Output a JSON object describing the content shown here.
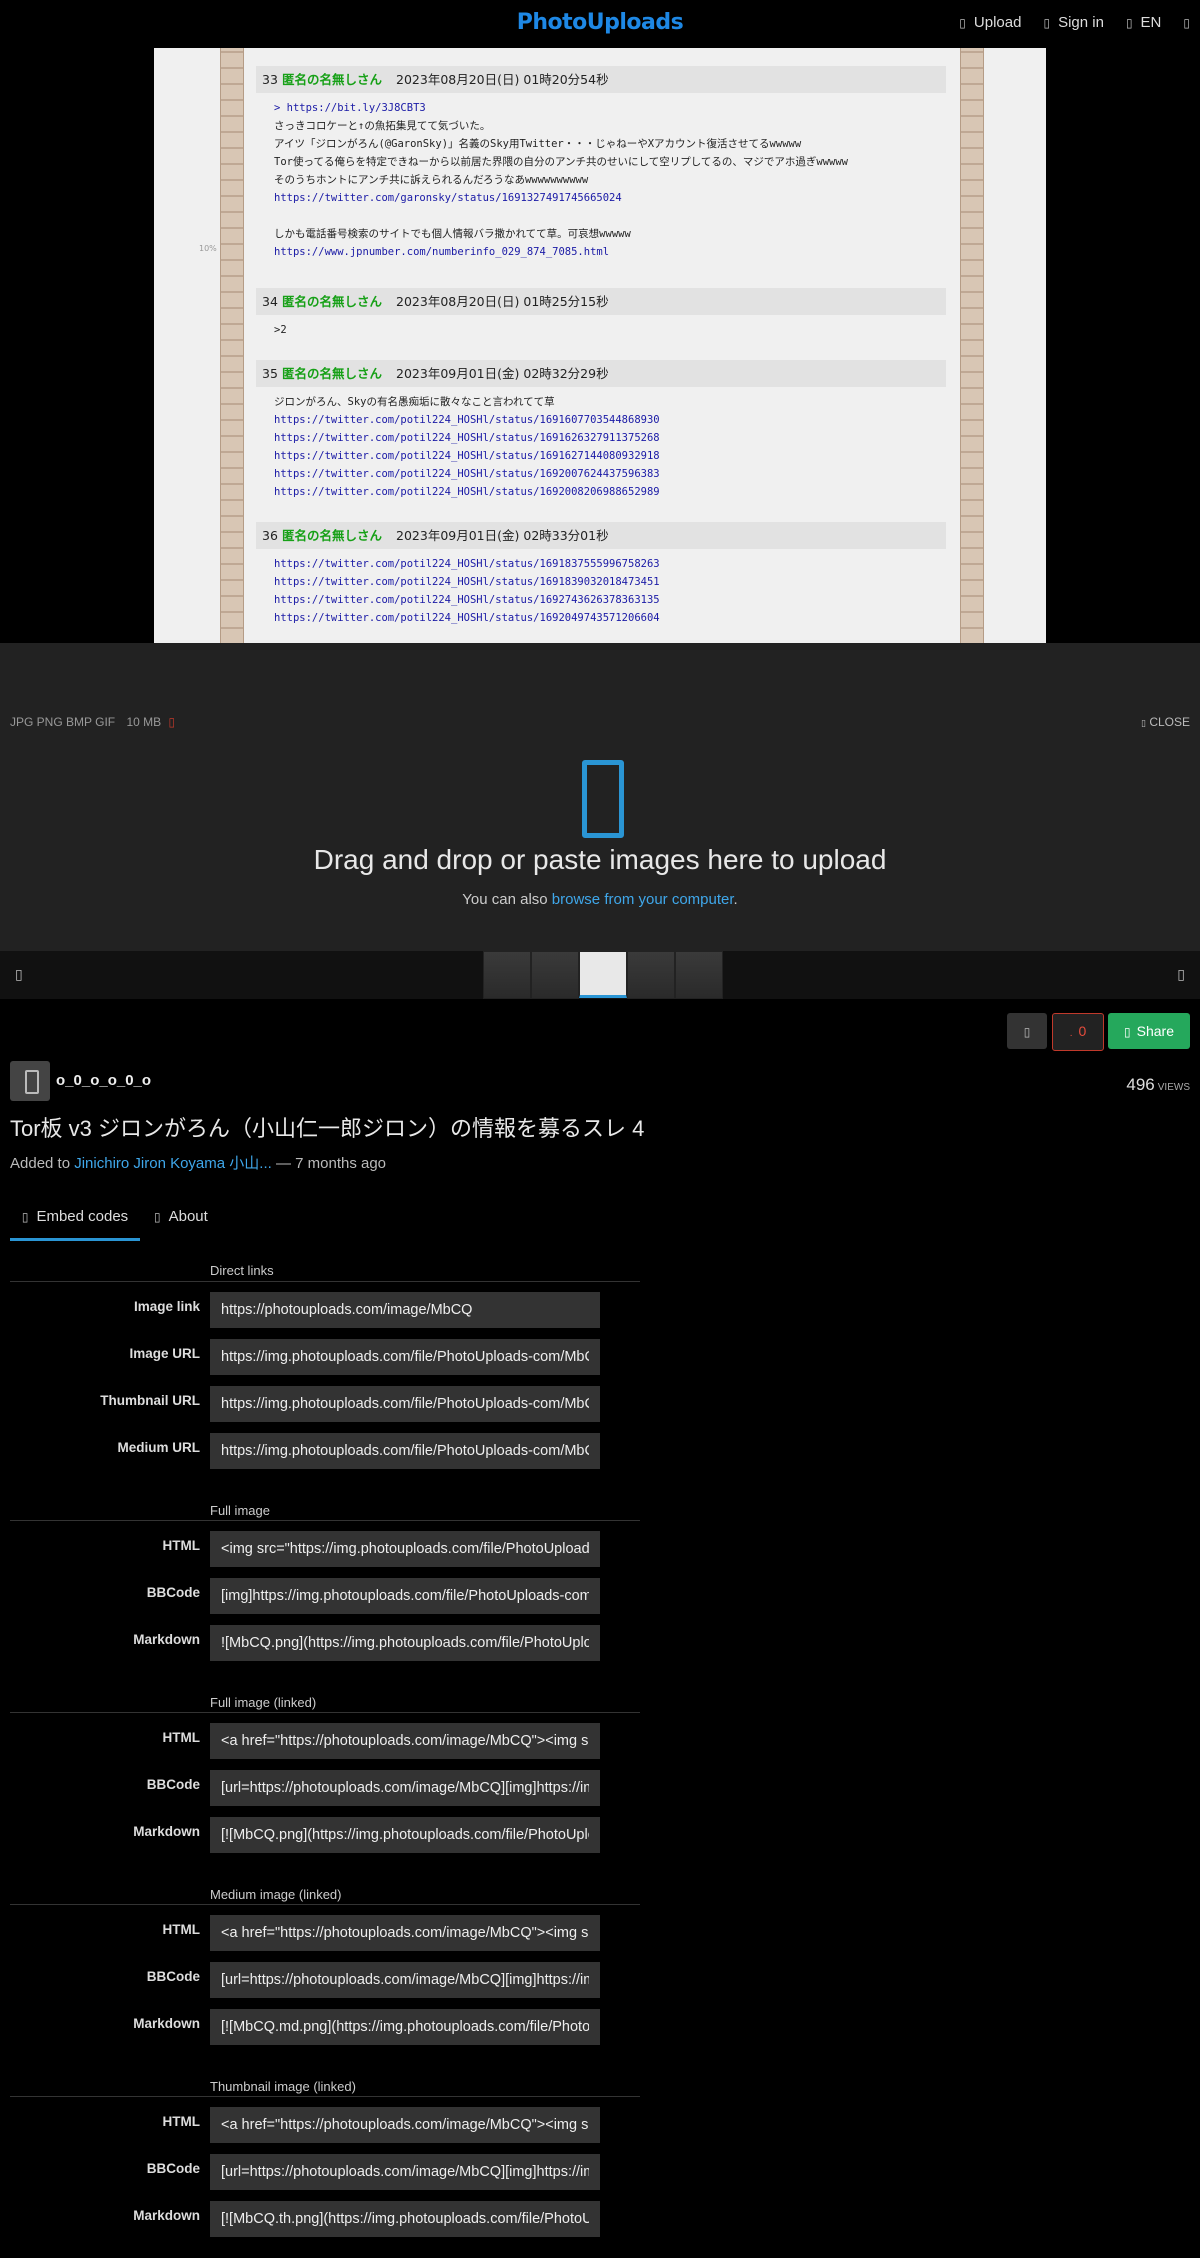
{
  "app": {
    "brand": "PhotoUploads"
  },
  "nav": {
    "upload": "Upload",
    "signin": "Sign in",
    "language": "EN"
  },
  "screenshot": {
    "side_pct": "10%",
    "posts": [
      {
        "num": "33",
        "name": "匿名の名無しさん",
        "date": "2023年08月20日(日) 01時20分54秒",
        "lines": [
          {
            "t": "> https://bit.ly/3J8CBT3",
            "link": true
          },
          {
            "t": "さっきコロケーと↑の魚拓集見てて気づいた。",
            "link": false
          },
          {
            "t": "アイツ「ジロンがろん(@GaronSky)」名義のSky用Twitter・・・じゃねーやXアカウント復活させてるwwwww",
            "link": false
          },
          {
            "t": "Tor使ってる俺らを特定できねーから以前居た界隈の自分のアンチ共のせいにして空リプしてるの、マジでアホ過ぎwwwww",
            "link": false
          },
          {
            "t": "そのうちホントにアンチ共に訴えられるんだろうなあwwwwwwwwww",
            "link": false
          },
          {
            "t": "https://twitter.com/garonsky/status/1691327491745665024",
            "link": true
          },
          {
            "t": "しかも電話番号検索のサイトでも個人情報バラ撒かれてて草。可哀想wwwww",
            "link": false
          },
          {
            "t": "https://www.jpnumber.com/numberinfo_029_874_7085.html",
            "link": true
          }
        ]
      },
      {
        "num": "34",
        "name": "匿名の名無しさん",
        "date": "2023年08月20日(日) 01時25分15秒",
        "lines": [
          {
            "t": ">2",
            "link": false
          }
        ]
      },
      {
        "num": "35",
        "name": "匿名の名無しさん",
        "date": "2023年09月01日(金) 02時32分29秒",
        "lines": [
          {
            "t": "ジロンがろん、Skyの有名愚痴垢に散々なこと言われてて草",
            "link": false
          },
          {
            "t": "https://twitter.com/potil224_HOSHl/status/1691607703544868930",
            "link": true
          },
          {
            "t": "https://twitter.com/potil224_HOSHl/status/1691626327911375268",
            "link": true
          },
          {
            "t": "https://twitter.com/potil224_HOSHl/status/1691627144080932918",
            "link": true
          },
          {
            "t": "https://twitter.com/potil224_HOSHl/status/1692007624437596383",
            "link": true
          },
          {
            "t": "https://twitter.com/potil224_HOSHl/status/1692008206988652989",
            "link": true
          }
        ]
      },
      {
        "num": "36",
        "name": "匿名の名無しさん",
        "date": "2023年09月01日(金) 02時33分01秒",
        "lines": [
          {
            "t": "https://twitter.com/potil224_HOSHl/status/1691837555996758263",
            "link": true
          },
          {
            "t": "https://twitter.com/potil224_HOSHl/status/1691839032018473451",
            "link": true
          },
          {
            "t": "https://twitter.com/potil224_HOSHl/status/1692743626378363135",
            "link": true
          },
          {
            "t": "https://twitter.com/potil224_HOSHl/status/1692049743571206604",
            "link": true
          }
        ]
      }
    ]
  },
  "upload_panel": {
    "formats": "JPG PNG BMP GIF",
    "max_size": "10 MB",
    "close": "CLOSE",
    "title": "Drag and drop or paste images here to upload",
    "sub_prefix": "You can also ",
    "sub_link": "browse from your computer",
    "sub_suffix": "."
  },
  "actions": {
    "like_count": "0",
    "share": "Share"
  },
  "image": {
    "username": "o_0_o_o_0_o",
    "views": "496",
    "views_label": "VIEWS",
    "title": "Tor板 v3 ジロンがろん（小山仁一郎ジロン）の情報を募るスレ 4",
    "added_prefix": "Added to ",
    "album": "Jinichiro Jiron Koyama 小山...",
    "added_suffix": " — 7 months ago"
  },
  "tabs": {
    "embed": "Embed codes",
    "about": "About"
  },
  "embed": {
    "direct": {
      "title": "Direct links",
      "image_link_label": "Image link",
      "image_link": "https://photouploads.com/image/MbCQ",
      "image_url_label": "Image URL",
      "image_url": "https://img.photouploads.com/file/PhotoUploads-com/MbCQ.png",
      "thumb_url_label": "Thumbnail URL",
      "thumb_url": "https://img.photouploads.com/file/PhotoUploads-com/MbCQ.th.png",
      "medium_url_label": "Medium URL",
      "medium_url": "https://img.photouploads.com/file/PhotoUploads-com/MbCQ.md.png"
    },
    "full": {
      "title": "Full image",
      "html_label": "HTML",
      "html": "<img src=\"https://img.photouploads.com/file/PhotoUploads-com/MbCQ.png\" alt=\"MbCQ.png\" border=\"0\">",
      "bbcode_label": "BBCode",
      "bbcode": "[img]https://img.photouploads.com/file/PhotoUploads-com/MbCQ.png[/img]",
      "markdown_label": "Markdown",
      "markdown": "![MbCQ.png](https://img.photouploads.com/file/PhotoUploads-com/MbCQ.png)"
    },
    "full_linked": {
      "title": "Full image (linked)",
      "html_label": "HTML",
      "html": "<a href=\"https://photouploads.com/image/MbCQ\"><img src=\"https://img.photouploads.com/file/PhotoUploads-com/MbCQ.png\"></a>",
      "bbcode_label": "BBCode",
      "bbcode": "[url=https://photouploads.com/image/MbCQ][img]https://img.photouploads.com/file/PhotoUploads-com/MbCQ.png[/img][/url]",
      "markdown_label": "Markdown",
      "markdown": "[![MbCQ.png](https://img.photouploads.com/file/PhotoUploads-com/MbCQ.png)](https://photouploads.com/image/MbCQ)"
    },
    "medium_linked": {
      "title": "Medium image (linked)",
      "html_label": "HTML",
      "html": "<a href=\"https://photouploads.com/image/MbCQ\"><img src=\"https://img.photouploads.com/file/PhotoUploads-com/MbCQ.md.png\"></a>",
      "bbcode_label": "BBCode",
      "bbcode": "[url=https://photouploads.com/image/MbCQ][img]https://img.photouploads.com/file/PhotoUploads-com/MbCQ.md.png[/img][/url]",
      "markdown_label": "Markdown",
      "markdown": "[![MbCQ.md.png](https://img.photouploads.com/file/PhotoUploads-com/MbCQ.md.png)](https://photouploads.com/image/MbCQ)"
    },
    "thumb_linked": {
      "title": "Thumbnail image (linked)",
      "html_label": "HTML",
      "html": "<a href=\"https://photouploads.com/image/MbCQ\"><img src=\"https://img.photouploads.com/file/PhotoUploads-com/MbCQ.th.png\"></a>",
      "bbcode_label": "BBCode",
      "bbcode": "[url=https://photouploads.com/image/MbCQ][img]https://img.photouploads.com/file/PhotoUploads-com/MbCQ.th.png[/img][/url]",
      "markdown_label": "Markdown",
      "markdown": "[![MbCQ.th.png](https://img.photouploads.com/file/PhotoUploads-com/MbCQ.th.png)](https://photouploads.com/image/MbCQ)"
    }
  }
}
